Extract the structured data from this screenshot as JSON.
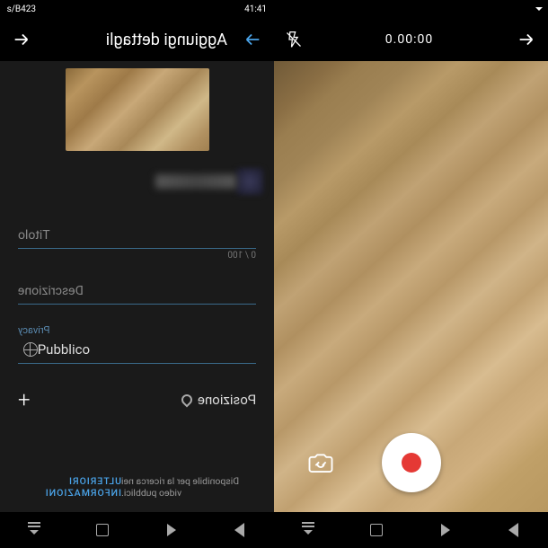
{
  "left": {
    "status": {
      "time": "14:14",
      "rate": "324B/s"
    },
    "header": {
      "title": "Aggiungi dettagli"
    },
    "form": {
      "title_label": "Titolo",
      "title_counter": "0 / 100",
      "desc_label": "Descrizione",
      "privacy_label": "Privacy",
      "privacy_value": "Pubblico",
      "location_label": "Posizione"
    },
    "footer": {
      "disp": "Disponibile per la ricerca nei video pubblici.",
      "info": "ULTERIORI INFORMAZIONI"
    }
  },
  "right": {
    "timer": "0.00:00"
  }
}
